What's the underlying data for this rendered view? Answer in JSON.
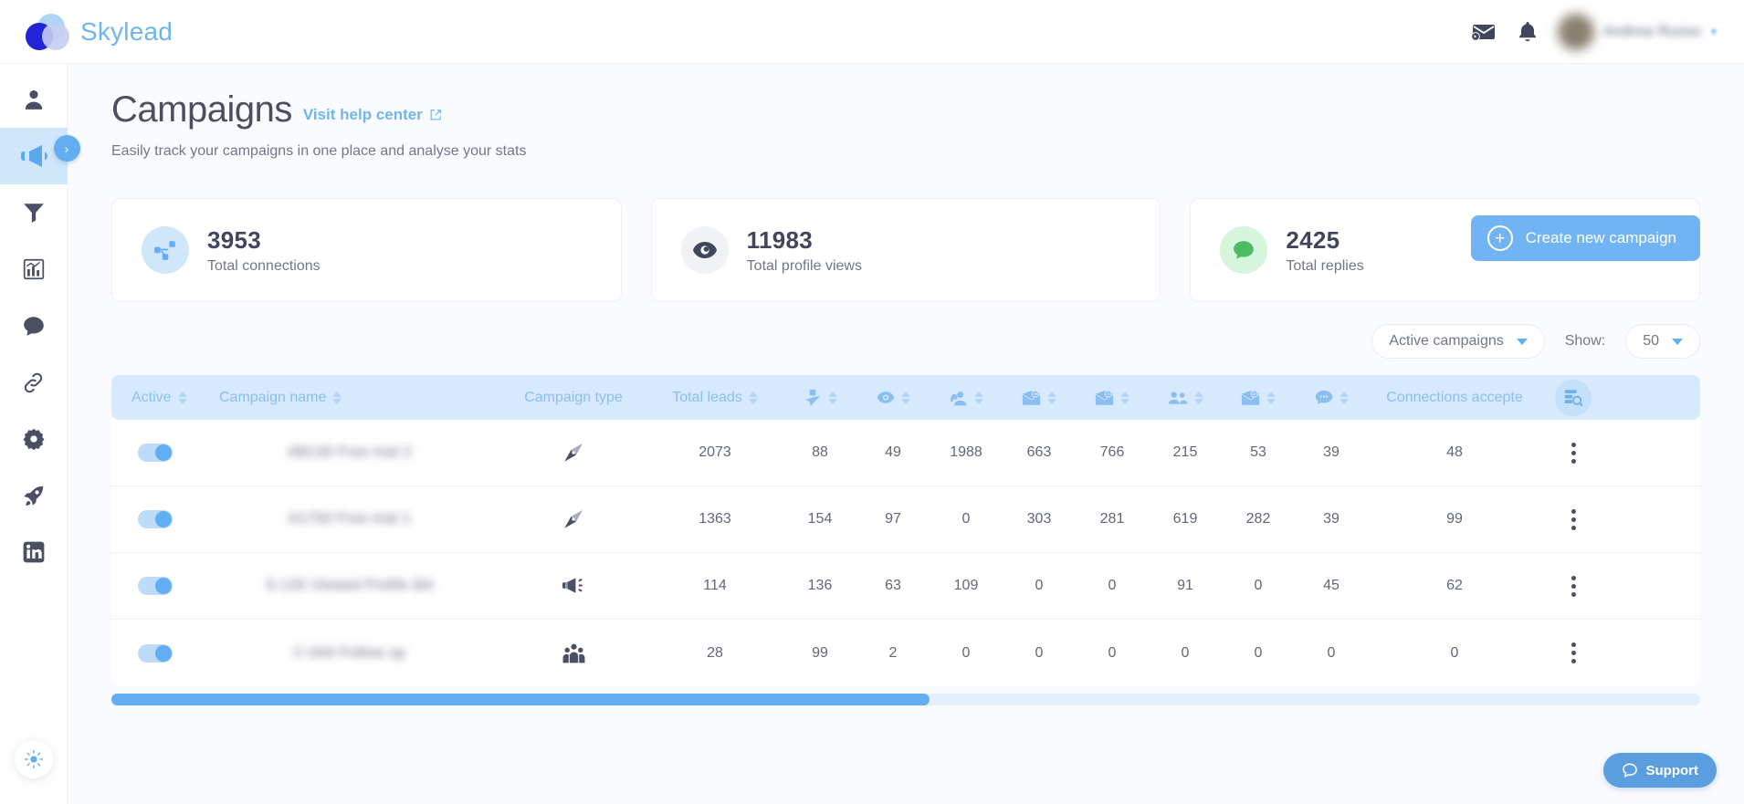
{
  "brand": {
    "name": "Skylead"
  },
  "topbar": {
    "mail_icon": "mail-icon",
    "bell_icon": "bell-icon",
    "username": "Andrea Russo",
    "chevron": "▾"
  },
  "sidebar": {
    "items": [
      {
        "name": "person-icon",
        "label": "Leads",
        "active": false
      },
      {
        "name": "megaphone-icon",
        "label": "Campaigns",
        "active": true
      },
      {
        "name": "funnel-icon",
        "label": "Filters",
        "active": false
      },
      {
        "name": "chart-icon",
        "label": "Reports",
        "active": false
      },
      {
        "name": "chat-icon",
        "label": "Inbox",
        "active": false
      },
      {
        "name": "link-icon",
        "label": "Integrations",
        "active": false
      },
      {
        "name": "gear-icon",
        "label": "Settings",
        "active": false
      },
      {
        "name": "rocket-icon",
        "label": "Launch",
        "active": false
      },
      {
        "name": "linkedin-icon",
        "label": "LinkedIn",
        "active": false
      }
    ],
    "theme_toggle": "sun-icon",
    "expander": "›"
  },
  "header": {
    "title": "Campaigns",
    "help_link": "Visit help center",
    "subtitle": "Easily track your campaigns in one place and analyse your stats",
    "cta_label": "Create new campaign",
    "cta_color": "#71b4f4"
  },
  "stats": [
    {
      "value": "3953",
      "label": "Total connections",
      "icon": "network-share-icon",
      "accent": "#62aef2"
    },
    {
      "value": "11983",
      "label": "Total profile views",
      "icon": "eye-icon",
      "accent": "#41465c"
    },
    {
      "value": "2425",
      "label": "Total replies",
      "icon": "chat-bubble-icon",
      "accent": "#4bbb64"
    }
  ],
  "controls": {
    "filter_value": "Active campaigns",
    "show_label": "Show:",
    "show_value": "50"
  },
  "table": {
    "columns": [
      {
        "key": "active",
        "label": "Active",
        "icon": null,
        "sortable": true
      },
      {
        "key": "name",
        "label": "Campaign name",
        "icon": null,
        "sortable": true
      },
      {
        "key": "type",
        "label": "Campaign type",
        "icon": null,
        "sortable": false
      },
      {
        "key": "leads",
        "label": "Total leads",
        "icon": null,
        "sortable": true
      },
      {
        "key": "invites",
        "label": "",
        "icon": "linkedin-paperplane-icon",
        "sortable": true
      },
      {
        "key": "views",
        "label": "",
        "icon": "eye-icon",
        "sortable": true
      },
      {
        "key": "inmails",
        "label": "",
        "icon": "person-headset-icon",
        "sortable": true
      },
      {
        "key": "emails_sent",
        "label": "",
        "icon": "envelope-sent-icon",
        "sortable": true
      },
      {
        "key": "emails_opened",
        "label": "",
        "icon": "envelope-open-icon",
        "sortable": true
      },
      {
        "key": "connections",
        "label": "",
        "icon": "people-icon",
        "sortable": true
      },
      {
        "key": "messages",
        "label": "",
        "icon": "envelope-message-icon",
        "sortable": true
      },
      {
        "key": "replies",
        "label": "",
        "icon": "chat-dots-icon",
        "sortable": true
      },
      {
        "key": "accepted",
        "label": "Connections accepte",
        "icon": null,
        "sortable": false
      },
      {
        "key": "search",
        "label": "",
        "icon": "column-search-icon",
        "sortable": false
      }
    ],
    "rows": [
      {
        "active": true,
        "name": "AB130 Free trial 2",
        "type_icon": "compass-icon",
        "leads": "2073",
        "invites": "88",
        "views": "49",
        "inmails": "1988",
        "emails_sent": "663",
        "emails_opened": "766",
        "connections": "215",
        "messages": "53",
        "replies": "39",
        "accepted": "48"
      },
      {
        "active": true,
        "name": "A1750 Free trial 1",
        "type_icon": "compass-icon",
        "leads": "1363",
        "invites": "154",
        "views": "97",
        "inmails": "0",
        "emails_sent": "303",
        "emails_opened": "281",
        "connections": "619",
        "messages": "282",
        "replies": "39",
        "accepted": "99"
      },
      {
        "active": true,
        "name": "S-135 Viewed Profile BA",
        "type_icon": "megaphone-icon",
        "leads": "114",
        "invites": "136",
        "views": "63",
        "inmails": "109",
        "emails_sent": "0",
        "emails_opened": "0",
        "connections": "91",
        "messages": "0",
        "replies": "45",
        "accepted": "62"
      },
      {
        "active": true,
        "name": "C-044 Follow up",
        "type_icon": "group-icon",
        "leads": "28",
        "invites": "99",
        "views": "2",
        "inmails": "0",
        "emails_sent": "0",
        "emails_opened": "0",
        "connections": "0",
        "messages": "0",
        "replies": "0",
        "accepted": "0"
      }
    ],
    "scroll_percent": "51.5"
  },
  "support": {
    "label": "Support",
    "icon": "chat-bubble-icon"
  }
}
